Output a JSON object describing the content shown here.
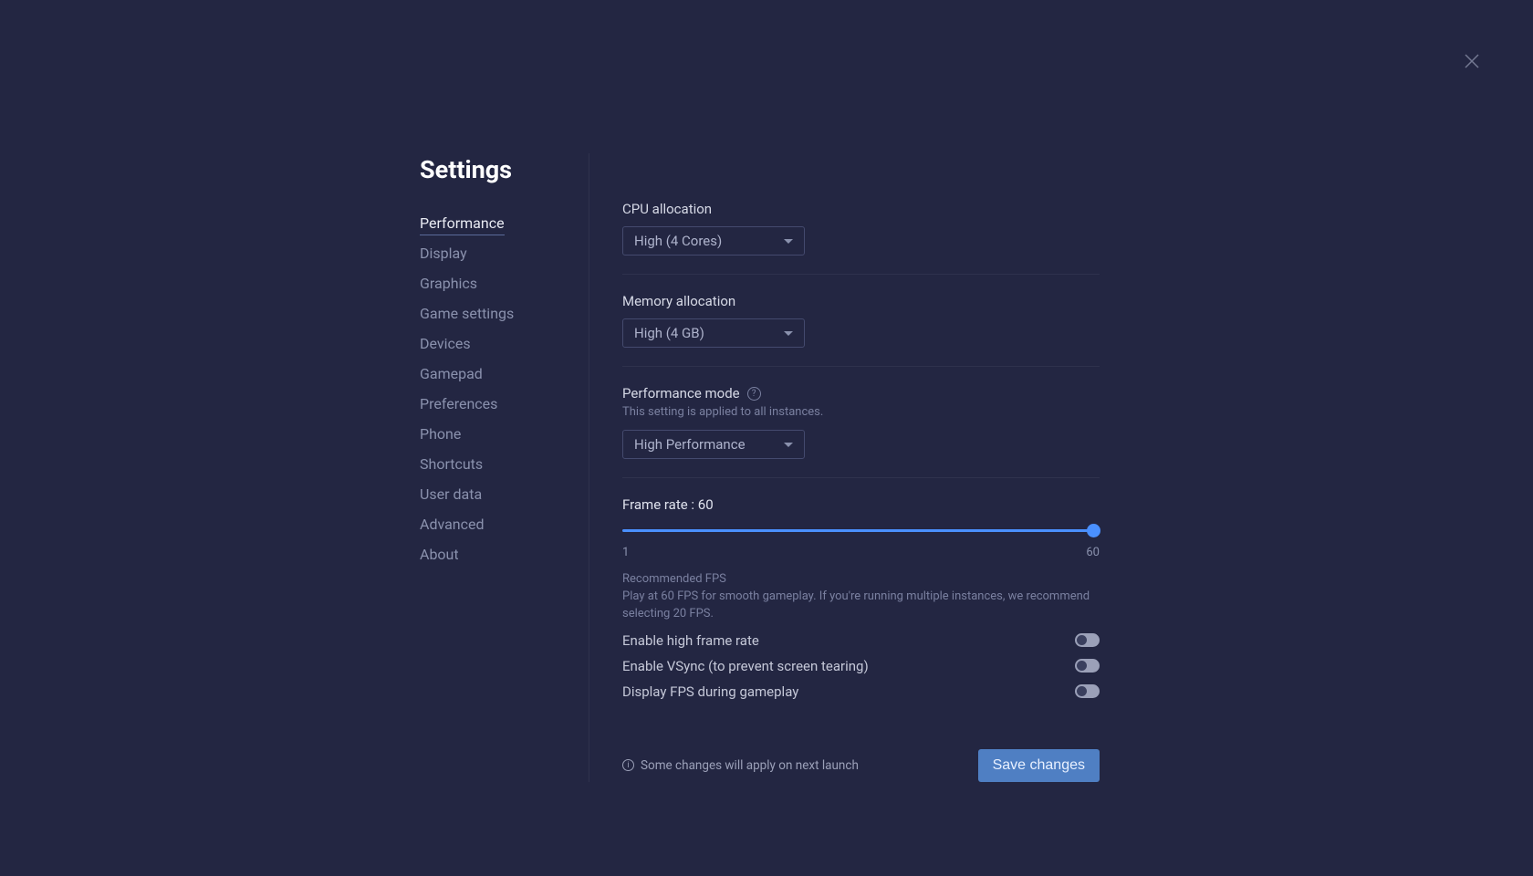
{
  "page_title": "Settings",
  "sidebar": {
    "items": [
      {
        "label": "Performance",
        "active": true
      },
      {
        "label": "Display"
      },
      {
        "label": "Graphics"
      },
      {
        "label": "Game settings"
      },
      {
        "label": "Devices"
      },
      {
        "label": "Gamepad"
      },
      {
        "label": "Preferences"
      },
      {
        "label": "Phone"
      },
      {
        "label": "Shortcuts"
      },
      {
        "label": "User data"
      },
      {
        "label": "Advanced"
      },
      {
        "label": "About"
      }
    ]
  },
  "cpu": {
    "label": "CPU allocation",
    "value": "High (4 Cores)"
  },
  "memory": {
    "label": "Memory allocation",
    "value": "High (4 GB)"
  },
  "perf_mode": {
    "label": "Performance mode",
    "note": "This setting is applied to all instances.",
    "value": "High Performance"
  },
  "frame_rate": {
    "label": "Frame rate : 60",
    "min": "1",
    "max": "60",
    "recommended_heading": "Recommended FPS",
    "recommended_desc": "Play at 60 FPS for smooth gameplay. If you're running multiple instances, we recommend selecting 20 FPS."
  },
  "toggles": {
    "high_fr": "Enable high frame rate",
    "vsync": "Enable VSync (to prevent screen tearing)",
    "display_fps": "Display FPS during gameplay"
  },
  "footer": {
    "note": "Some changes will apply on next launch",
    "save": "Save changes"
  }
}
